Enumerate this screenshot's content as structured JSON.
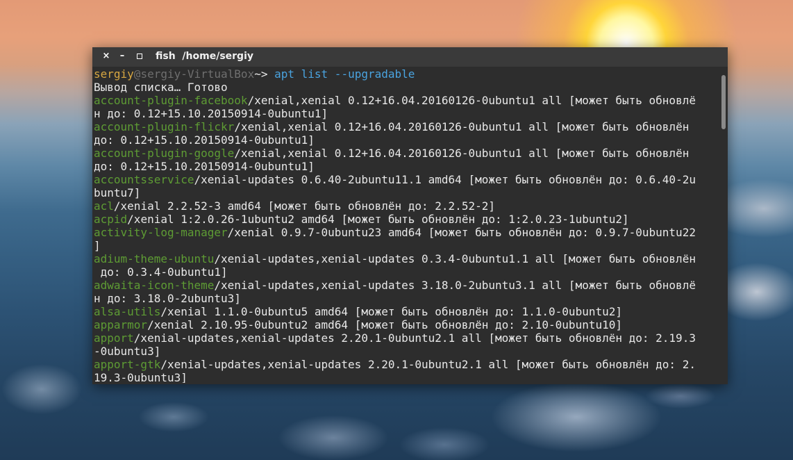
{
  "window": {
    "title": "fish  /home/sergiy",
    "close_glyph": "×",
    "minimize_glyph": "–"
  },
  "prompt": {
    "user": "sergiy",
    "at": "@",
    "host": "sergiy-VirtualBox",
    "path": "~",
    "arrow": "> ",
    "command": "apt list --upgradable"
  },
  "output_header": "Вывод списка… Готово",
  "lines": [
    {
      "pkg": "account-plugin-facebook",
      "text": "/xenial,xenial 0.12+16.04.20160126-0ubuntu1 all [может быть обновлё"
    },
    {
      "pkg": "",
      "text": "н до: 0.12+15.10.20150914-0ubuntu1]"
    },
    {
      "pkg": "account-plugin-flickr",
      "text": "/xenial,xenial 0.12+16.04.20160126-0ubuntu1 all [может быть обновлён"
    },
    {
      "pkg": "",
      "text": "до: 0.12+15.10.20150914-0ubuntu1]"
    },
    {
      "pkg": "account-plugin-google",
      "text": "/xenial,xenial 0.12+16.04.20160126-0ubuntu1 all [может быть обновлён"
    },
    {
      "pkg": "",
      "text": "до: 0.12+15.10.20150914-0ubuntu1]"
    },
    {
      "pkg": "accountsservice",
      "text": "/xenial-updates 0.6.40-2ubuntu11.1 amd64 [может быть обновлён до: 0.6.40-2u"
    },
    {
      "pkg": "",
      "text": "buntu7]"
    },
    {
      "pkg": "acl",
      "text": "/xenial 2.2.52-3 amd64 [может быть обновлён до: 2.2.52-2]"
    },
    {
      "pkg": "acpid",
      "text": "/xenial 1:2.0.26-1ubuntu2 amd64 [может быть обновлён до: 1:2.0.23-1ubuntu2]"
    },
    {
      "pkg": "activity-log-manager",
      "text": "/xenial 0.9.7-0ubuntu23 amd64 [может быть обновлён до: 0.9.7-0ubuntu22"
    },
    {
      "pkg": "",
      "text": "]"
    },
    {
      "pkg": "adium-theme-ubuntu",
      "text": "/xenial-updates,xenial-updates 0.3.4-0ubuntu1.1 all [может быть обновлён"
    },
    {
      "pkg": "",
      "text": " до: 0.3.4-0ubuntu1]"
    },
    {
      "pkg": "adwaita-icon-theme",
      "text": "/xenial-updates,xenial-updates 3.18.0-2ubuntu3.1 all [может быть обновлё"
    },
    {
      "pkg": "",
      "text": "н до: 3.18.0-2ubuntu3]"
    },
    {
      "pkg": "alsa-utils",
      "text": "/xenial 1.1.0-0ubuntu5 amd64 [может быть обновлён до: 1.1.0-0ubuntu2]"
    },
    {
      "pkg": "apparmor",
      "text": "/xenial 2.10.95-0ubuntu2 amd64 [может быть обновлён до: 2.10-0ubuntu10]"
    },
    {
      "pkg": "apport",
      "text": "/xenial-updates,xenial-updates 2.20.1-0ubuntu2.1 all [может быть обновлён до: 2.19.3"
    },
    {
      "pkg": "",
      "text": "-0ubuntu3]"
    },
    {
      "pkg": "apport-gtk",
      "text": "/xenial-updates,xenial-updates 2.20.1-0ubuntu2.1 all [может быть обновлён до: 2."
    },
    {
      "pkg": "",
      "text": "19.3-0ubuntu3]"
    }
  ],
  "colors": {
    "terminal_bg": "#2d2d2d",
    "titlebar_bg": "#3a3a3a",
    "user": "#d7a742",
    "host": "#6f6f6f",
    "command": "#4aa3df",
    "package": "#5e9c34",
    "text": "#e8e8e8"
  }
}
